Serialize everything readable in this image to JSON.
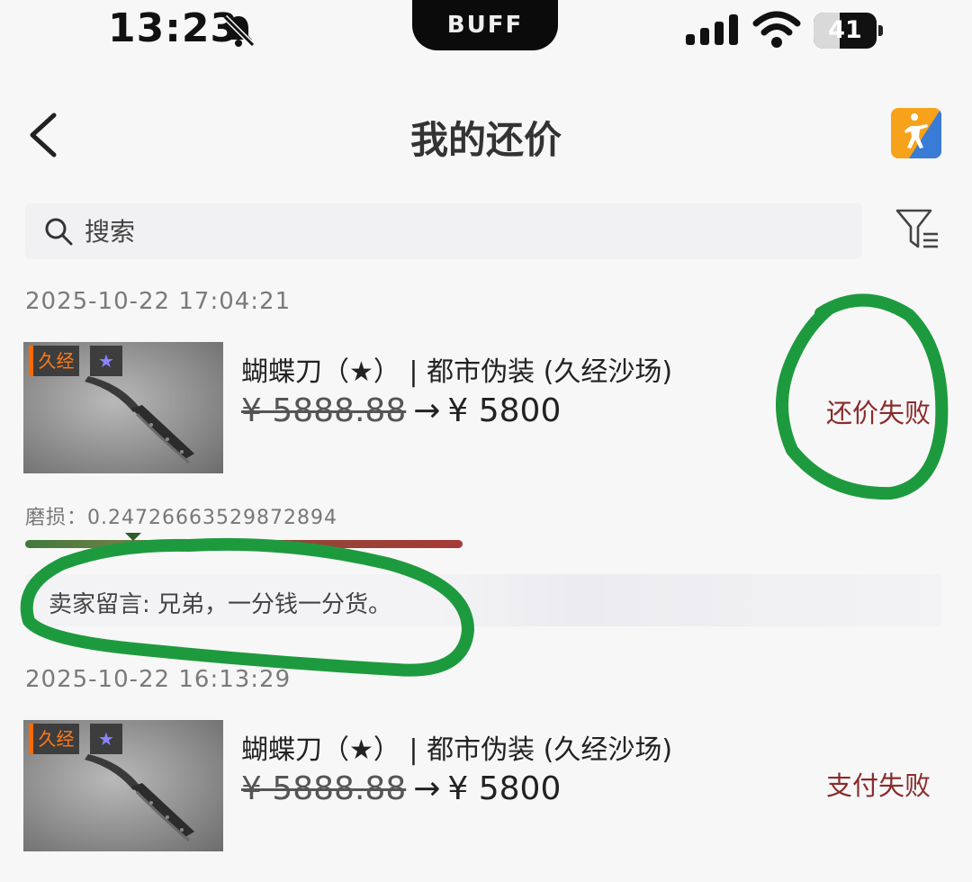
{
  "status_bar": {
    "time": "13:23",
    "center_label": "BUFF",
    "battery_percent": "41",
    "battery_level": 0.41,
    "icons": [
      "bell-off-icon",
      "signal-icon",
      "wifi-icon",
      "battery-icon"
    ]
  },
  "nav": {
    "title": "我的还价",
    "back_icon": "chevron-left-icon",
    "game_icon": "counter-strike-icon"
  },
  "search": {
    "placeholder": "搜索",
    "filter_icon": "filter-icon"
  },
  "records": [
    {
      "time": "2025-10-22 17:04:21",
      "tag": "久经",
      "star": "★",
      "name": "蝴蝶刀（★） | 都市伪装 (久经沙场)",
      "old_price": "¥ 5888.88",
      "arrow": "→",
      "new_price": "¥ 5800",
      "status": "还价失败",
      "wear_label": "磨损：0.24726663529872894",
      "wear_value": 0.24726663529872894,
      "seller_note": "卖家留言: 兄弟，一分钱一分货。"
    },
    {
      "time": "2025-10-22 16:13:29",
      "tag": "久经",
      "star": "★",
      "name": "蝴蝶刀（★） | 都市伪装 (久经沙场)",
      "old_price": "¥ 5888.88",
      "arrow": "→",
      "new_price": "¥ 5800",
      "status": "支付失败"
    }
  ],
  "colors": {
    "status_text": "#8a2c2c",
    "tag_orange": "#ff6a00",
    "star_purple": "#8a84ff",
    "annotation_green": "#1e9a3e",
    "game_icon_orange": "#f7a21b",
    "game_icon_blue": "#3a7bd5"
  }
}
